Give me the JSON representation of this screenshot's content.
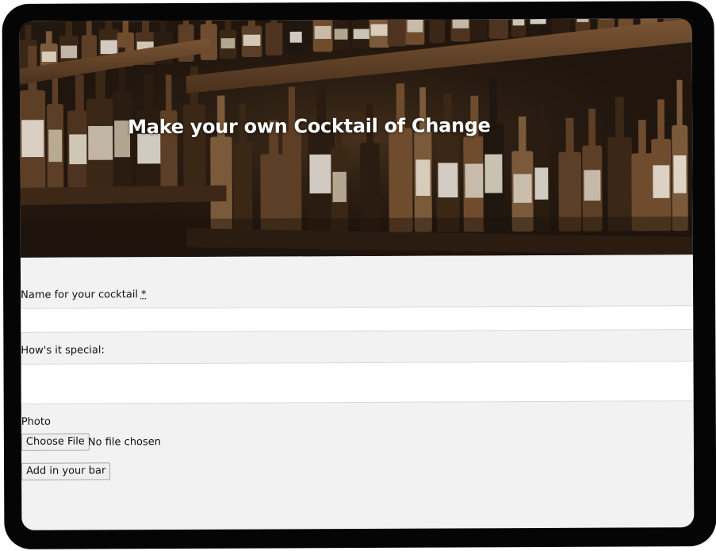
{
  "hero": {
    "title": "Make your own Cocktail of Change"
  },
  "form": {
    "name_label": "Name for your cocktail",
    "required_marker": "*",
    "name_value": "",
    "special_label": "How's it special:",
    "special_value": "",
    "photo_label": "Photo",
    "choose_file_label": "Choose File",
    "file_status": "No file chosen",
    "submit_label": "Add in your bar"
  }
}
